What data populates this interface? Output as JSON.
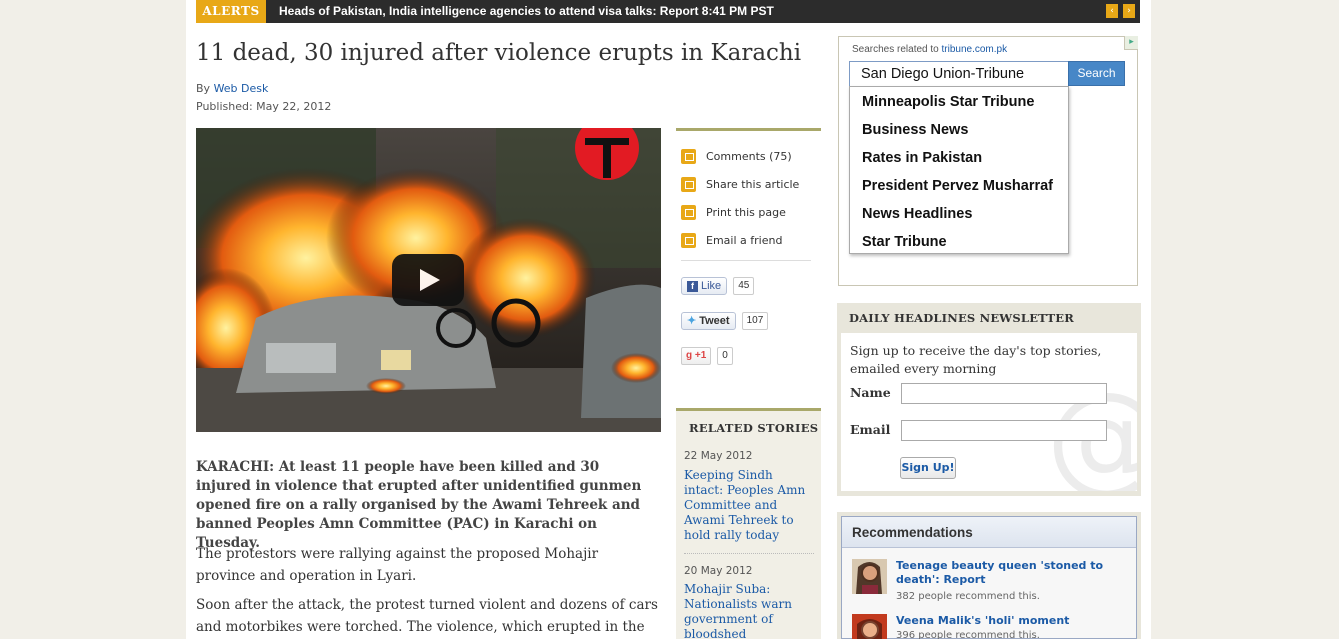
{
  "alerts": {
    "tag": "ALERTS",
    "text": "Heads of Pakistan, India intelligence agencies to attend visa talks: Report 8:41 PM PST",
    "prev": "‹",
    "next": "›"
  },
  "article": {
    "headline": "11 dead, 30 injured after violence erupts in Karachi",
    "by_prefix": "By ",
    "author": "Web Desk",
    "published": "Published: May 22, 2012",
    "lead": "KARACHI: At least 11 people have been killed and 30 injured in violence that erupted after unidentified gunmen opened fire on a rally organised by the Awami Tehreek and banned Peoples Amn Committee (PAC) in Karachi on Tuesday.",
    "paragraphs": [
      "The protestors were rallying against the proposed Mohajir province and operation in Lyari.",
      "Soon after the attack, the protest turned violent and dozens of cars and motorbikes were torched. The violence, which erupted in the"
    ]
  },
  "tools": {
    "comments": "Comments (75)",
    "share": "Share this article",
    "print": "Print this page",
    "email": "Email a friend"
  },
  "social": {
    "like_label": "Like",
    "like_count": "45",
    "tweet_label": "Tweet",
    "tweet_count": "107",
    "plus_label": "+1",
    "plus_count": "0"
  },
  "related": {
    "title": "RELATED STORIES",
    "items": [
      {
        "date": "22 May 2012",
        "title": "Keeping Sindh intact: Peoples Amn Committee and Awami Tehreek to hold rally today"
      },
      {
        "date": "20 May 2012",
        "title": "Mohajir Suba: Nationalists warn government of bloodshed"
      }
    ]
  },
  "search": {
    "related_prefix": "Searches related to ",
    "related_site": "tribune.com.pk",
    "query": "San Diego Union-Tribune",
    "button": "Search",
    "suggestions": [
      "Minneapolis Star Tribune",
      "Business News",
      "Rates in Pakistan",
      "President Pervez Musharraf",
      "News Headlines",
      "Star Tribune"
    ]
  },
  "newsletter": {
    "title": "DAILY HEADLINES NEWSLETTER",
    "description": "Sign up to receive the day's top stories, emailed every morning",
    "name_label": "Name",
    "email_label": "Email",
    "button": "Sign Up!"
  },
  "recommendations": {
    "title": "Recommendations",
    "items": [
      {
        "title": "Teenage beauty queen 'stoned to death': Report",
        "count": "382 people recommend this."
      },
      {
        "title": "Veena Malik's 'holi' moment",
        "count": "396 people recommend this."
      }
    ]
  },
  "colors": {
    "accent": "#e8a817",
    "link": "#1b5aa6",
    "rule": "#a9a86a"
  }
}
